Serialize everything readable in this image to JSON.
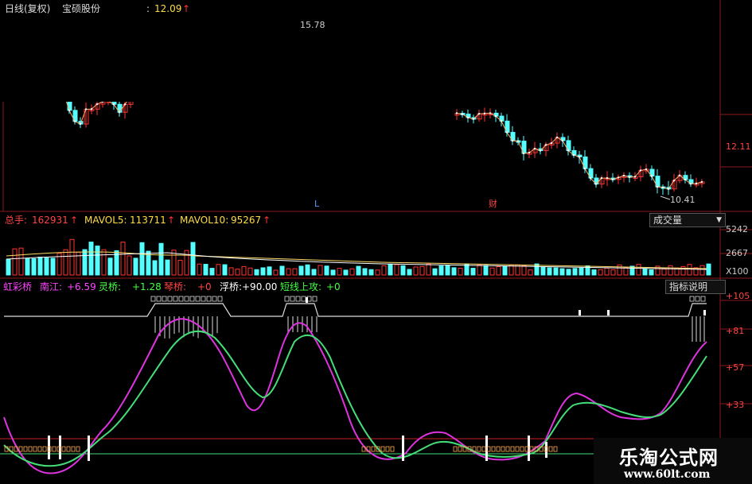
{
  "header": {
    "period": "日线(复权)",
    "stock_name": "宝硕股份",
    "price": "12.09",
    "price_arrow": "↑"
  },
  "price_annotations": {
    "high_label": "15.78",
    "low_label": "10.41",
    "right_axis_label": "12.11",
    "marker_L": "L",
    "marker_cai": "财"
  },
  "volume_panel": {
    "total_label": "总手:",
    "total_value": "162931",
    "mavol5_label": "MAVOL5:",
    "mavol5_value": "113711",
    "mavol10_label": "MAVOL10:",
    "mavol10_value": "95267",
    "dropdown_label": "成交量",
    "axis_labels": [
      "5242",
      "2667",
      "X100"
    ]
  },
  "indicator_panel": {
    "name": "虹彩桥",
    "items": [
      {
        "label": "南江:",
        "value": "+6.59",
        "color": "#ff44ff"
      },
      {
        "label": "灵桥:",
        "value": "+1.28",
        "color": "#44ff44"
      },
      {
        "label": "琴桥:",
        "value": "+0",
        "color": "#ff4444"
      },
      {
        "label": "浮桥:",
        "value": "+90.00",
        "color": "#ffffff"
      },
      {
        "label": "短线上攻:",
        "value": "+0",
        "color": "#44ff44"
      }
    ],
    "explain_button": "指标说明",
    "axis_labels": [
      "+105",
      "+81",
      "+57",
      "+33"
    ]
  },
  "watermark": {
    "title": "乐淘公式网",
    "url": "www.60lt.com"
  },
  "chart_data": {
    "type": "line",
    "price_series": {
      "high": 15.78,
      "low": 10.41,
      "last": 12.09
    },
    "volume_series": {
      "mavol5": 113711,
      "mavol10": 95267,
      "total": 162931
    },
    "indicator_series": [
      {
        "name": "南江",
        "last": 6.59
      },
      {
        "name": "灵桥",
        "last": 1.28
      }
    ],
    "indicator_ylim": [
      0,
      105
    ],
    "colors": {
      "up": "#ff3333",
      "down": "#55ffff",
      "ma": "#ffaa66",
      "magenta": "#dd33dd",
      "green": "#44dd77",
      "bridge": "#ffffff",
      "red_level": "#cc2222"
    }
  }
}
